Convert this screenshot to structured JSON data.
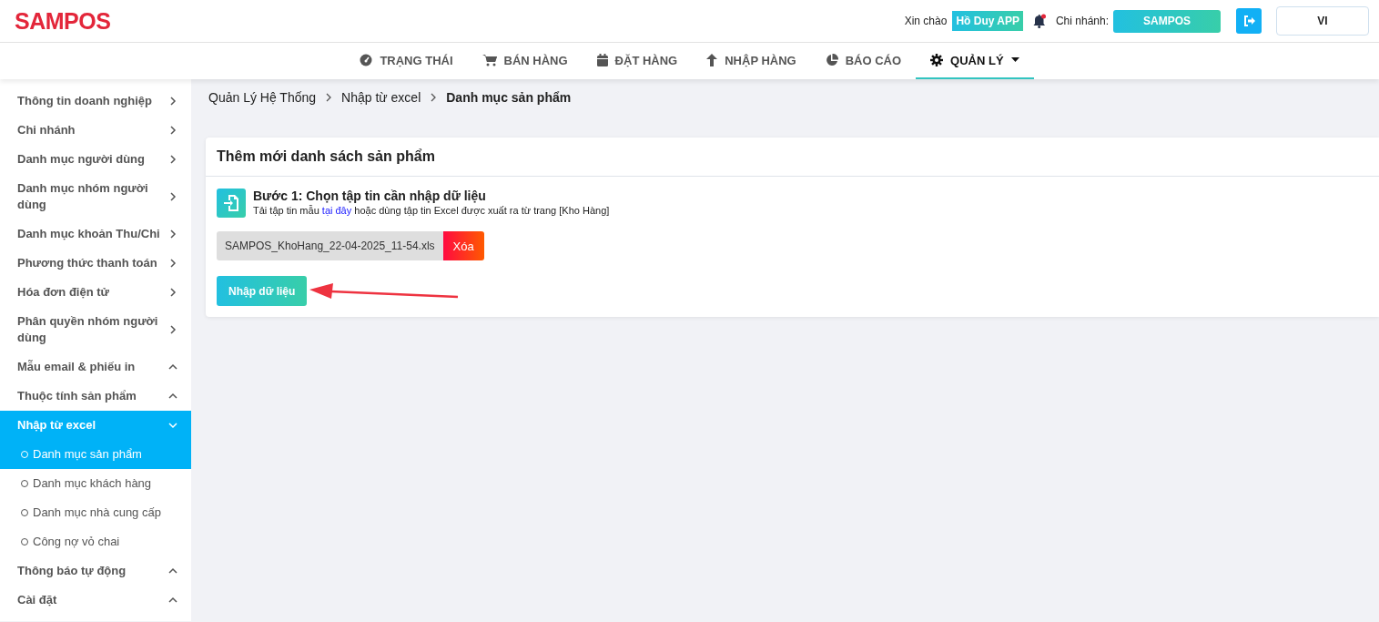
{
  "header": {
    "logo": "SAMPOS",
    "greeting": "Xin chào",
    "user": "Hồ Duy APP",
    "notification": true,
    "branch_label": "Chi nhánh:",
    "branch": "SAMPOS",
    "language": "VI"
  },
  "nav": [
    {
      "label": "TRẠNG THÁI",
      "kind": "status",
      "selected": false
    },
    {
      "label": "BÁN HÀNG",
      "kind": "sales",
      "selected": false
    },
    {
      "label": "ĐẶT HÀNG",
      "kind": "orders",
      "selected": false
    },
    {
      "label": "NHẬP HÀNG",
      "kind": "purchase",
      "selected": false
    },
    {
      "label": "BÁO CÁO",
      "kind": "reports",
      "selected": false
    },
    {
      "label": "QUẢN LÝ",
      "kind": "admin",
      "selected": true
    }
  ],
  "sidebar": {
    "items": [
      {
        "label": "Thông tin doanh nghiệp",
        "kind": "link"
      },
      {
        "label": "Chi nhánh",
        "kind": "link"
      },
      {
        "label": "Danh mục người dùng",
        "kind": "link"
      },
      {
        "label": "Danh mục nhóm người dùng",
        "kind": "link"
      },
      {
        "label": "Danh mục khoản Thu/Chi",
        "kind": "link"
      },
      {
        "label": "Phương thức thanh toán",
        "kind": "link"
      },
      {
        "label": "Hóa đơn điện tử",
        "kind": "link"
      },
      {
        "label": "Phân quyền nhóm người dùng",
        "kind": "link"
      },
      {
        "label": "Mẫu email & phiếu in",
        "kind": "group",
        "expanded": false,
        "selected": false
      },
      {
        "label": "Thuộc tính sản phẩm",
        "kind": "group",
        "expanded": false,
        "selected": false
      },
      {
        "label": "Nhập từ excel",
        "kind": "group",
        "expanded": true,
        "selected": true,
        "children": [
          {
            "label": "Danh mục sản phẩm",
            "selected": true
          },
          {
            "label": "Danh mục khách hàng",
            "selected": false
          },
          {
            "label": "Danh mục nhà cung cấp",
            "selected": false
          },
          {
            "label": "Công nợ vỏ chai",
            "selected": false
          }
        ]
      },
      {
        "label": "Thông báo tự động",
        "kind": "group",
        "expanded": false,
        "selected": false
      },
      {
        "label": "Cài đặt",
        "kind": "group",
        "expanded": false,
        "selected": false
      }
    ]
  },
  "breadcrumb": [
    "Quản Lý Hệ Thống",
    "Nhập từ excel",
    "Danh mục sản phẩm"
  ],
  "card": {
    "title": "Thêm mới danh sách sản phẩm",
    "step_title": "Bước 1: Chọn tập tin cần nhập dữ liệu",
    "step_hint_before": "Tải tập tin mẫu",
    "step_link": "tại đây",
    "step_hint_after": "hoặc dùng tập tin Excel được xuất ra từ trang [Kho Hàng]",
    "file_name": "SAMPOS_KhoHang_22-04-2025_11-54.xls",
    "delete_button": "Xóa",
    "import_button": "Nhập dữ liệu"
  }
}
